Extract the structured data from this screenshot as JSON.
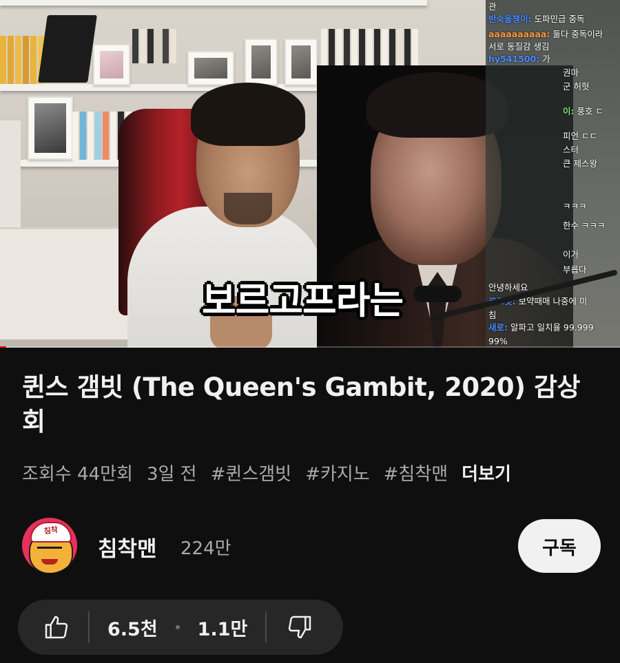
{
  "video": {
    "subtitle_caption": "보르고프라는",
    "progress_fraction": 0.01,
    "chat": [
      {
        "nick": "",
        "text": "관"
      },
      {
        "nick": "반숙올챙이:",
        "text": " 도파민급 중독",
        "nick_color": "blue"
      },
      {
        "nick": "aaaaaaaaaa:",
        "text": " 둘다 중독이라",
        "nick_color": "orange"
      },
      {
        "nick": "",
        "text": "서로 동질감 생김"
      },
      {
        "nick": "hy541500:",
        "text": " 가",
        "nick_color": "blue"
      },
      {
        "nick": "",
        "text": "권마"
      },
      {
        "nick": "",
        "text": "군 허헛"
      },
      {
        "nick": "이:",
        "text": " 풍호 ㄷ",
        "nick_color": "green"
      },
      {
        "nick": "",
        "text": "피언 ㄷㄷ"
      },
      {
        "nick": "",
        "text": "스터"
      },
      {
        "nick": "",
        "text": "큰 제스왕"
      },
      {
        "nick": "",
        "text": "ㅋㅋㅋ"
      },
      {
        "nick": "",
        "text": "한수 ㅋㅋㅋ"
      },
      {
        "nick": "",
        "text": "이거"
      },
      {
        "nick": "",
        "text": "부릅다"
      },
      {
        "nick": "",
        "text": "안녕하세요"
      },
      {
        "nick": "코코넛:",
        "text": " 보약때매 나중에 미"
      },
      {
        "nick": "",
        "text": "침"
      },
      {
        "nick": "새로:",
        "text": " 알파고 일치율 99.999"
      },
      {
        "nick": "",
        "text": "99%"
      }
    ]
  },
  "title": "퀸스 갬빗 (The Queen's Gambit, 2020) 감상회",
  "meta": {
    "views": "조회수 44만회",
    "age": "3일 전",
    "tags": [
      "#퀸스갬빗",
      "#카지노",
      "#침착맨"
    ],
    "more_label": "더보기"
  },
  "channel": {
    "name": "침착맨",
    "subscribers": "224만",
    "subscribe_label": "구독",
    "avatar_cap_text": "침착"
  },
  "actions": {
    "likes": "6.5천",
    "dislikes_or_count": "1.1만"
  },
  "colors": {
    "background": "#0f0f0f",
    "text_primary": "#f1f1f1",
    "text_secondary": "#aaaaaa",
    "pill": "#272727",
    "subscribe_bg": "#f1f1f1",
    "progress": "#ff0000"
  },
  "icons": [
    "thumbs-up-icon",
    "thumbs-down-icon"
  ]
}
